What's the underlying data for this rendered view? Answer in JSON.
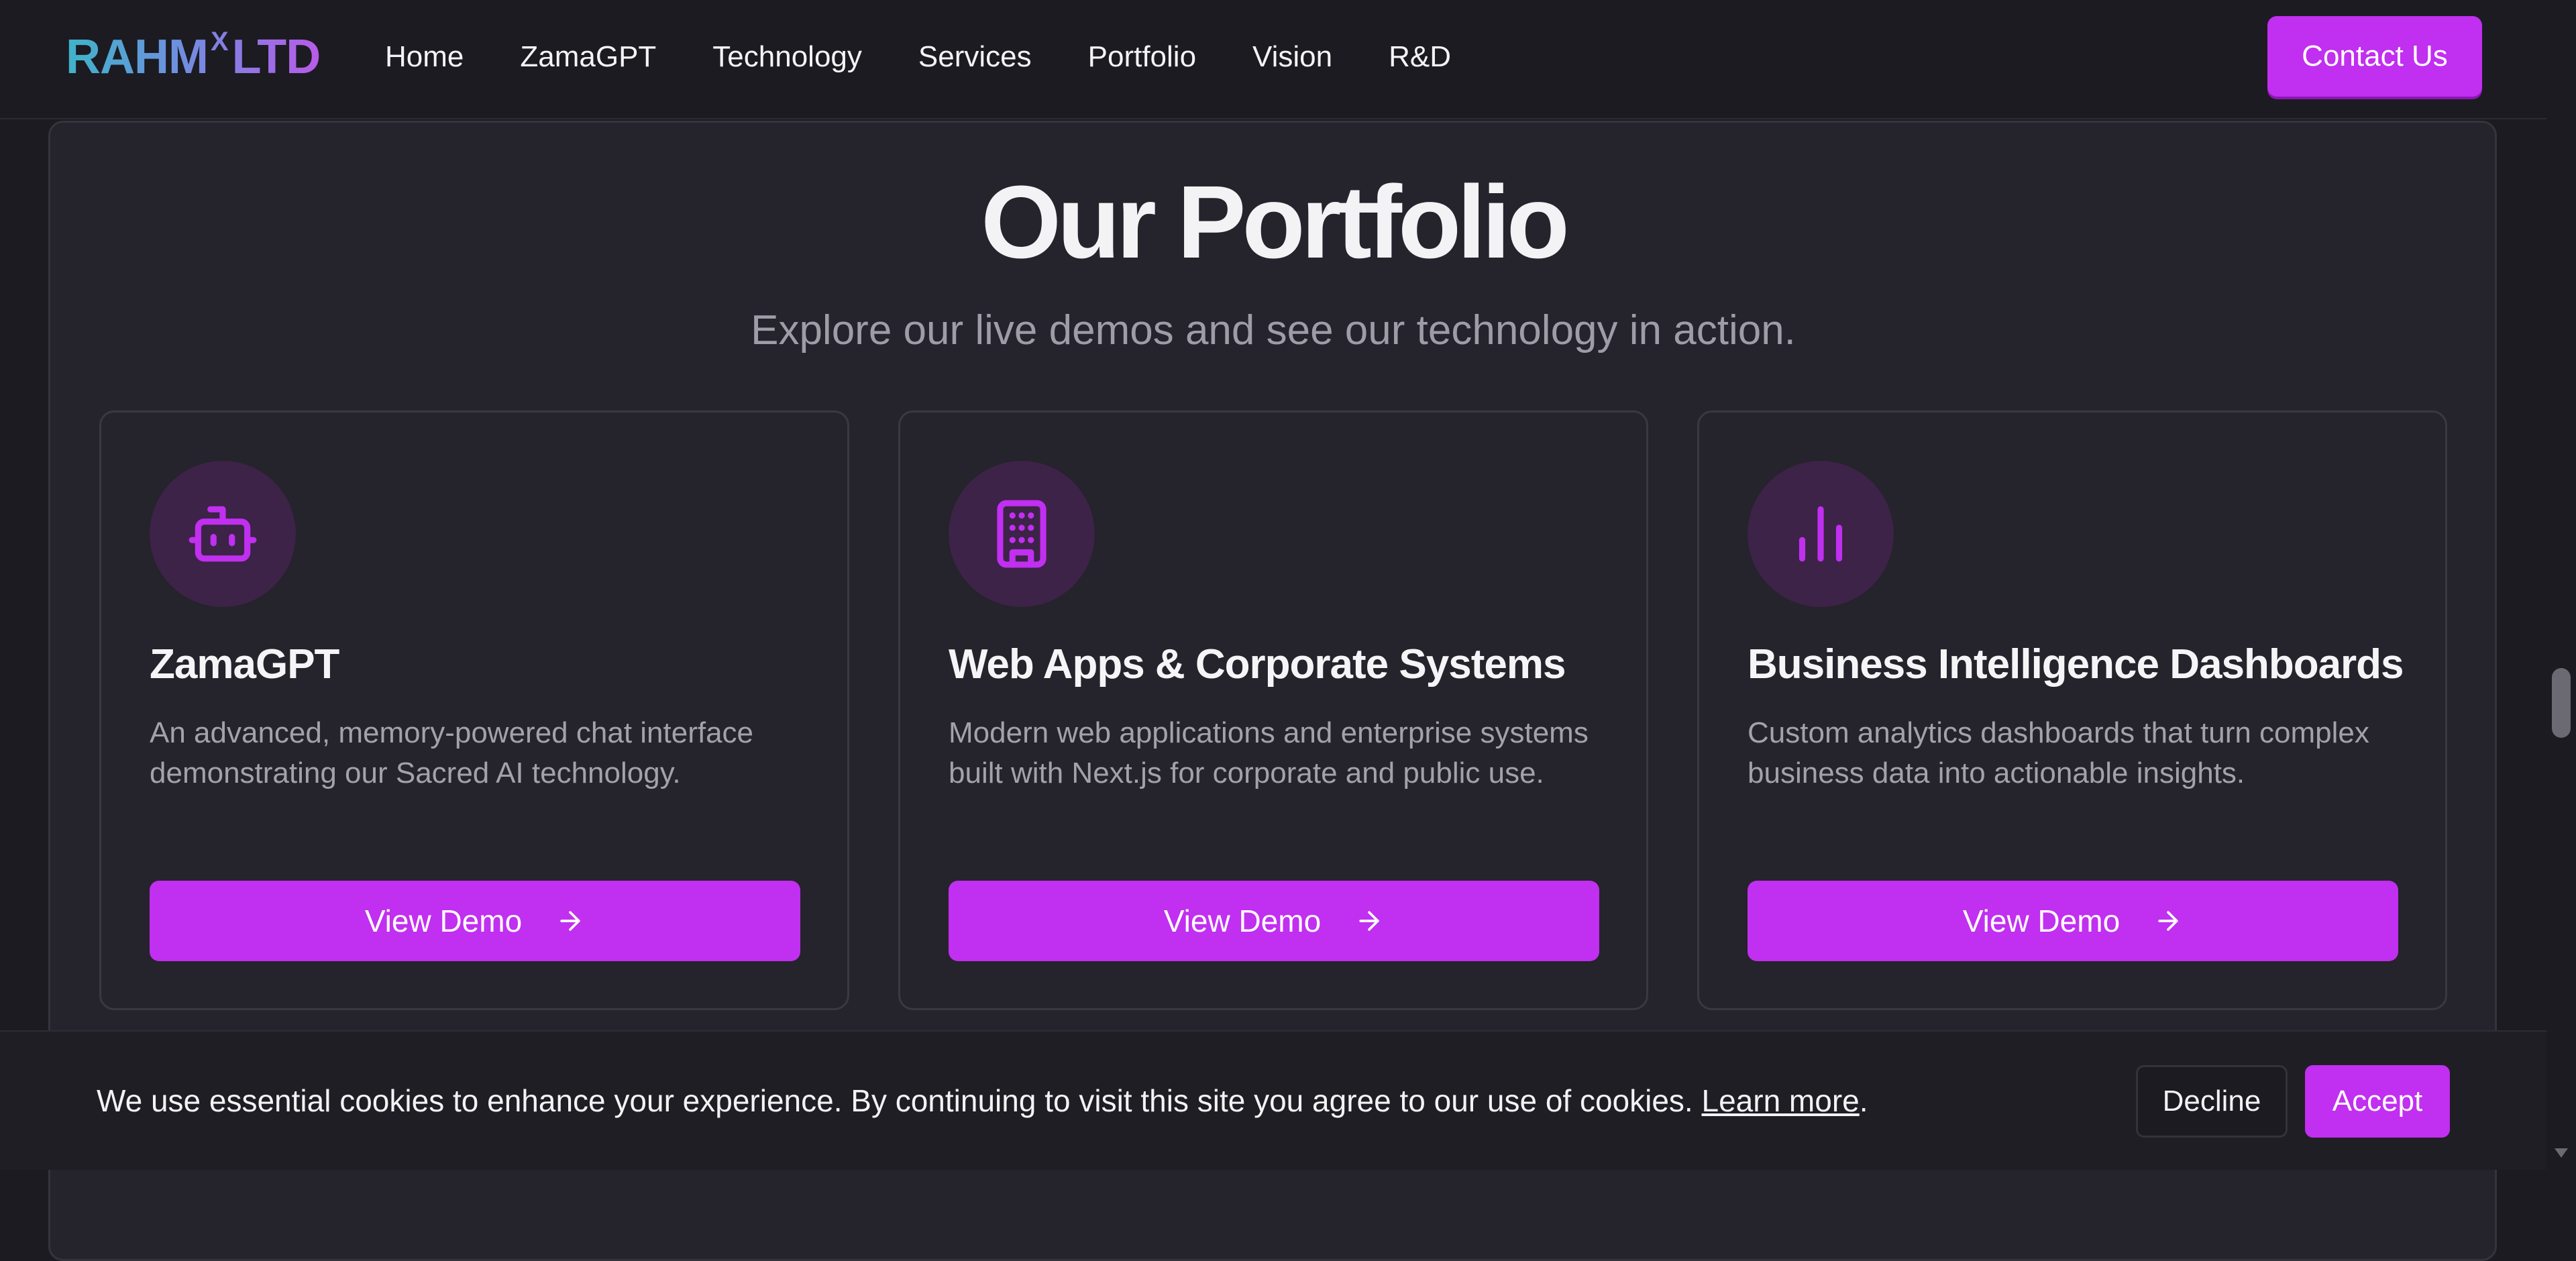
{
  "header": {
    "logo": {
      "main_left": "RAHM",
      "superscript": "X",
      "main_right": "LTD"
    },
    "nav": [
      "Home",
      "ZamaGPT",
      "Technology",
      "Services",
      "Portfolio",
      "Vision",
      "R&D"
    ],
    "contact_label": "Contact Us"
  },
  "portfolio": {
    "title": "Our Portfolio",
    "subtitle": "Explore our live demos and see our technology in action.",
    "cards": [
      {
        "icon": "robot-icon",
        "title": "ZamaGPT",
        "description": "An advanced, memory-powered chat interface demonstrating our Sacred AI technology.",
        "button": "View Demo"
      },
      {
        "icon": "building-icon",
        "title": "Web Apps & Corporate Systems",
        "description": "Modern web applications and enterprise systems built with Next.js for corporate and public use.",
        "button": "View Demo"
      },
      {
        "icon": "bar-chart-icon",
        "title": "Business Intelligence Dashboards",
        "description": "Custom analytics dashboards that turn complex business data into actionable insights.",
        "button": "View Demo"
      }
    ]
  },
  "cookie_banner": {
    "text": "We use essential cookies to enhance your experience. By continuing to visit this site you agree to our use of cookies.",
    "learn_more": "Learn more",
    "trailing": ".",
    "decline_label": "Decline",
    "accept_label": "Accept"
  },
  "colors": {
    "accent": "#c12ff0",
    "background": "#1c1b22",
    "panel": "#25232b",
    "muted_text": "#a3a1aa"
  }
}
